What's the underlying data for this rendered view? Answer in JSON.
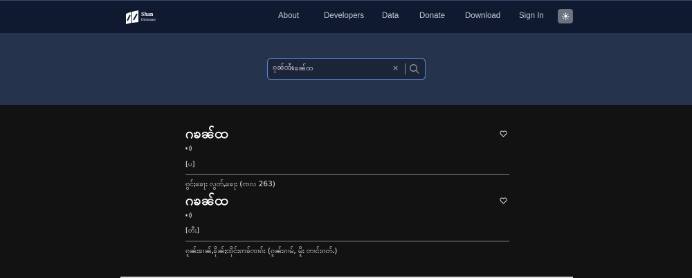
{
  "logo": {
    "line1": "Shan",
    "line2": "Dictionary"
  },
  "nav": [
    {
      "label": "About"
    },
    {
      "label": "Developers"
    },
    {
      "label": "Data"
    },
    {
      "label": "Donate"
    },
    {
      "label": "Download"
    },
    {
      "label": "Sign In"
    }
  ],
  "search": {
    "prefix": "ၵုၼ်ထႆး",
    "value": "ဂၶၼ်ထ",
    "clear_symbol": "×"
  },
  "entries": [
    {
      "word": "ဂၶၼ်ထ",
      "pos": "[ပ]",
      "definition": "ၵွင်ႈၶေႃး လွတ်ႇၶေႃး (ၸလ 263)"
    },
    {
      "word": "ဂၶၼ်ထ",
      "pos": "[တီႈ]",
      "definition": "ၵူၼ်းၶၢၼ်ႇၶိုၼ်ႈထိုင်းဢၶ်ၸၢၵ်း (ၵူၼ်းၵၢမ်, မိူး တၢင်းၵတ်ႉ)"
    }
  ],
  "colors": {
    "topbar": "#0f1a30",
    "band": "#25344c",
    "body": "#121212",
    "search_border": "#5a86d8",
    "theme_button": "#6b7280"
  }
}
